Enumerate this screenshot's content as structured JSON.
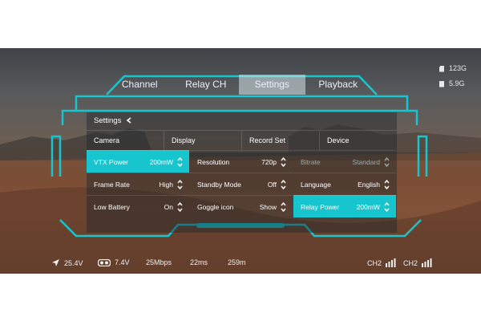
{
  "storage": {
    "sd_card": "123G",
    "goggle": "5.9G"
  },
  "tabs": [
    "Channel",
    "Relay CH",
    "Settings",
    "Playback"
  ],
  "active_tab": "Settings",
  "panel": {
    "title": "Settings",
    "categories": [
      "Camera",
      "Display",
      "Record Set",
      "Device"
    ],
    "rows": [
      [
        {
          "label": "VTX Power",
          "value": "200mW"
        },
        {
          "label": "Resolution",
          "value": "720p"
        },
        {
          "label": "Bitrate",
          "value": "Standard"
        }
      ],
      [
        {
          "label": "Frame Rate",
          "value": "High"
        },
        {
          "label": "Standby Mode",
          "value": "Off"
        },
        {
          "label": "Language",
          "value": "English"
        }
      ],
      [
        {
          "label": "Low Battery",
          "value": "On"
        },
        {
          "label": "Goggle icon",
          "value": "Show"
        },
        {
          "label": "Relay Power",
          "value": "200mW"
        }
      ]
    ]
  },
  "status": {
    "drone_voltage": "25.4V",
    "goggle_voltage": "7.4V",
    "bitrate": "25Mbps",
    "latency": "22ms",
    "distance": "259m",
    "ch_a": "CH2",
    "ch_b": "CH2"
  },
  "colors": {
    "accent": "#17c5cf"
  }
}
